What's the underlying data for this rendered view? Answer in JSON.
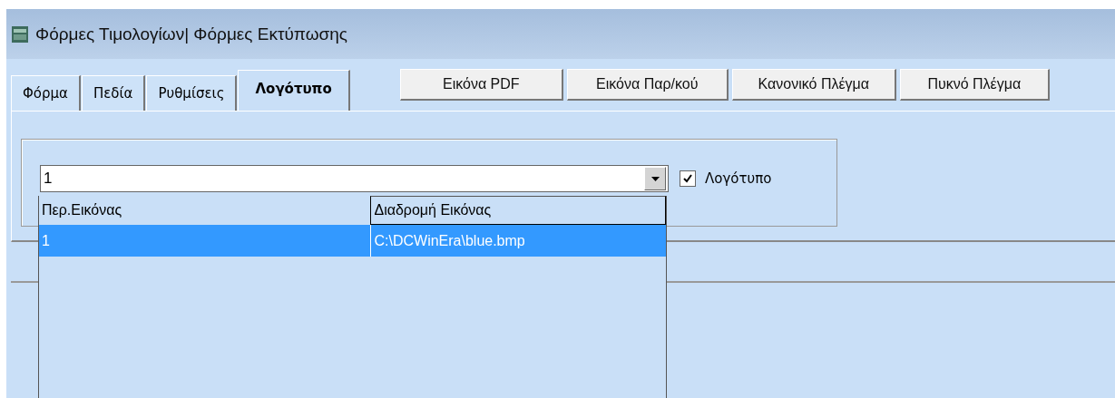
{
  "window": {
    "title": "Φόρμες Τιμολογίων| Φόρμες Εκτύπωσης"
  },
  "tabs": [
    {
      "label": "Φόρμα",
      "selected": false
    },
    {
      "label": "Πεδία",
      "selected": false
    },
    {
      "label": "Ρυθμίσεις",
      "selected": false
    },
    {
      "label": "Λογότυπο",
      "selected": true
    }
  ],
  "buttons": [
    "Εικόνα PDF",
    "Εικόνα Παρ/κού",
    "Κανονικό Πλέγμα",
    "Πυκνό Πλέγμα"
  ],
  "combo": {
    "value": "1",
    "expanded": true
  },
  "logo_checkbox": {
    "label": "Λογότυπο",
    "checked": true
  },
  "dropdown": {
    "columns": [
      "Περ.Εικόνας",
      "Διαδρομή Εικόνας"
    ],
    "rows": [
      {
        "cells": [
          "1",
          "C:\\DCWinEra\\blue.bmp"
        ],
        "selected": true
      }
    ]
  }
}
